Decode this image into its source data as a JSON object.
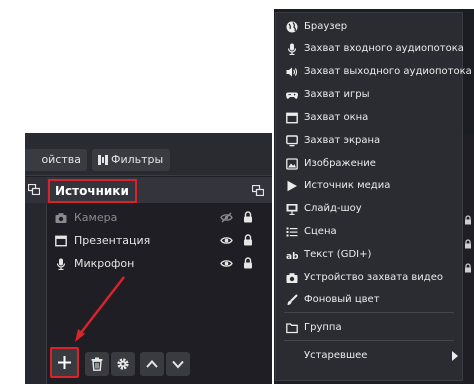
{
  "tabs": {
    "properties": "ойства",
    "filters": "Фильтры"
  },
  "sources": {
    "title": "Источники",
    "items": [
      {
        "label": "Камера",
        "icon": "camera-icon",
        "visible": false
      },
      {
        "label": "Презентация",
        "icon": "window-icon",
        "visible": true
      },
      {
        "label": "Микрофон",
        "icon": "microphone-icon",
        "visible": true
      }
    ]
  },
  "menu": {
    "items": [
      {
        "label": "Браузер",
        "icon": "globe-icon"
      },
      {
        "label": "Захват входного аудиопотока",
        "icon": "microphone-icon"
      },
      {
        "label": "Захват выходного аудиопотока",
        "icon": "speaker-icon"
      },
      {
        "label": "Захват игры",
        "icon": "gamepad-icon"
      },
      {
        "label": "Захват окна",
        "icon": "window-icon"
      },
      {
        "label": "Захват экрана",
        "icon": "monitor-icon"
      },
      {
        "label": "Изображение",
        "icon": "image-icon"
      },
      {
        "label": "Источник медиа",
        "icon": "play-icon"
      },
      {
        "label": "Слайд-шоу",
        "icon": "slideshow-icon"
      },
      {
        "label": "Сцена",
        "icon": "list-icon"
      },
      {
        "label": "Текст (GDI+)",
        "icon": "text-icon"
      },
      {
        "label": "Устройство захвата видео",
        "icon": "camera-icon"
      },
      {
        "label": "Фоновый цвет",
        "icon": "brush-icon"
      }
    ],
    "group": {
      "label": "Группа",
      "icon": "folder-icon"
    },
    "deprecated": {
      "label": "Устаревшее"
    }
  },
  "colors": {
    "highlight": "#d8232a",
    "panel": "#1e1e24",
    "menu": "#2b2c32"
  }
}
